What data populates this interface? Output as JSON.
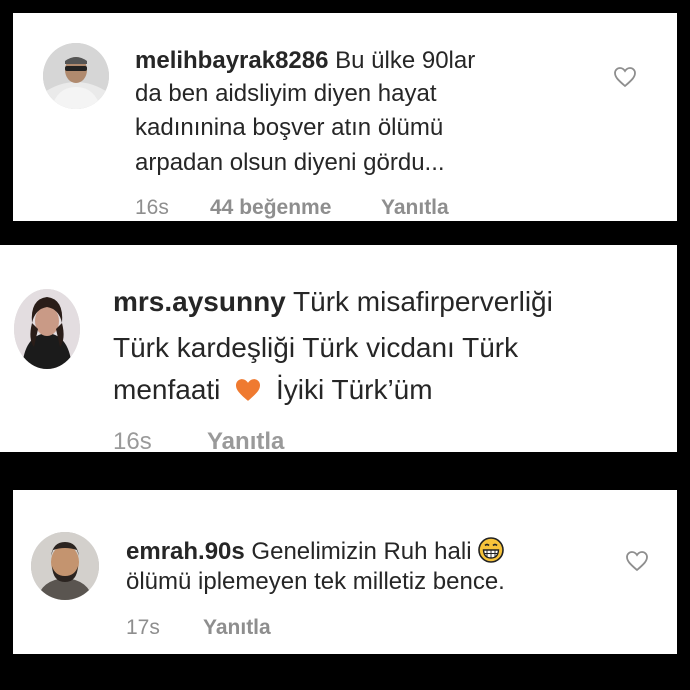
{
  "comments": [
    {
      "username": "melihbayrak8286",
      "text": {
        "line1": "Bu ülke 90lar",
        "line2": "da ben aidsliyim diyen hayat",
        "line3": "kadınınina boşver atın ölümü",
        "line4": "arpadan olsun diyeni gördu..."
      },
      "time": "16s",
      "likes": "44 beğenme",
      "reply": "Yanıtla",
      "avatar_icon": "avatar-man-sunglasses",
      "like_icon": "heart-outline-icon"
    },
    {
      "username": "mrs.aysunny",
      "text": {
        "line1": "Türk misafirperverliği",
        "line2": "Türk kardeşliği Türk vicdanı Türk",
        "line3_before": "menfaati",
        "line3_after": "İyiki Türk’üm"
      },
      "emoji": "orange-heart-icon",
      "time": "16s",
      "reply": "Yanıtla",
      "avatar_icon": "avatar-woman"
    },
    {
      "username": "emrah.90s",
      "text": {
        "line1": "Genelimizin Ruh hali",
        "line2": "ölümü iplemeyen tek milletiz bence."
      },
      "emoji": "grinning-face-icon",
      "time": "17s",
      "reply": "Yanıtla",
      "avatar_icon": "avatar-bearded-man",
      "like_icon": "heart-outline-icon"
    }
  ],
  "colors": {
    "background": "#000000",
    "card": "#ffffff",
    "text": "#262626",
    "meta": "#8e8e8e",
    "heart_emoji": "#ef7a30",
    "grin_emoji": "#f7c33a"
  }
}
